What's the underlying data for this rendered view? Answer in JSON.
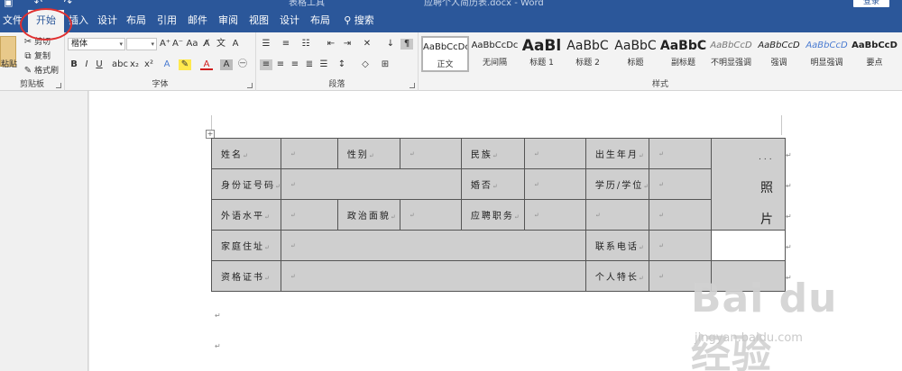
{
  "titlebar": {
    "context_label": "表格工具",
    "document_title": "应聘个人简历表.docx - Word",
    "login_label": "登录"
  },
  "menubar": {
    "tabs": [
      "文件",
      "开始",
      "插入",
      "设计",
      "布局",
      "引用",
      "邮件",
      "审阅",
      "视图",
      "设计",
      "布局"
    ],
    "active_tab": "开始",
    "search_label": "搜索"
  },
  "ribbon": {
    "clipboard": {
      "label": "剪贴板",
      "paste": "粘贴",
      "cut": "剪切",
      "copy": "复制",
      "format_painter": "格式刷"
    },
    "font": {
      "label": "字体",
      "font_name": "楷体",
      "font_size": ""
    },
    "paragraph": {
      "label": "段落"
    },
    "styles": {
      "label": "样式",
      "items": [
        {
          "sample": "AaBbCcDc",
          "name": "正文"
        },
        {
          "sample": "AaBbCcDc",
          "name": "无间隔"
        },
        {
          "sample": "AaBl",
          "name": "标题 1"
        },
        {
          "sample": "AaBbC",
          "name": "标题 2"
        },
        {
          "sample": "AaBbC",
          "name": "标题"
        },
        {
          "sample": "AaBbC",
          "name": "副标题"
        },
        {
          "sample": "AaBbCcD",
          "name": "不明显强调"
        },
        {
          "sample": "AaBbCcD",
          "name": "强调"
        },
        {
          "sample": "AaBbCcD",
          "name": "明显强调"
        },
        {
          "sample": "AaBbCcD",
          "name": "要点"
        }
      ]
    }
  },
  "table": {
    "rows": [
      [
        "姓名",
        "",
        "性别",
        "",
        "民族",
        "",
        "出生年月",
        ""
      ],
      [
        "身份证号码",
        "",
        "婚否",
        "",
        "学历/学位",
        ""
      ],
      [
        "外语水平",
        "",
        "政治面貌",
        "",
        "应聘职务",
        "",
        "",
        ""
      ],
      [
        "家庭住址",
        "",
        "联系电话",
        ""
      ],
      [
        "资格证书",
        "",
        "个人特长",
        ""
      ]
    ],
    "photo_chars": [
      "照",
      "片"
    ],
    "photo_dots": "...",
    "cell_mark": "↵"
  },
  "watermark": {
    "brand": "Bai du 经验",
    "url": "jingyan.baidu.com"
  },
  "colors": {
    "accent": "#2b579a",
    "annotation": "#e03030",
    "cell_fill": "#cfcfcf"
  }
}
